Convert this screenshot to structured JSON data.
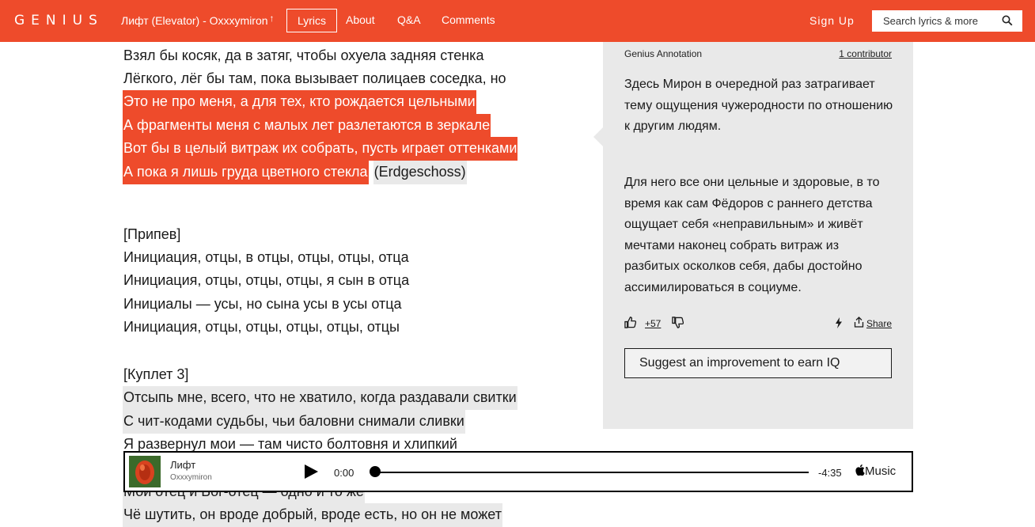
{
  "header": {
    "logo": "GENIUS",
    "song_title": "Лифт (Elevator) - Oxxxymiron",
    "song_title_arrow": "↑",
    "nav": [
      "Lyrics",
      "About",
      "Q&A",
      "Comments"
    ],
    "active_nav": "Lyrics",
    "sign_up": "Sign Up",
    "search_placeholder": "Search lyrics & more",
    "accent_color": "#ee4b2b"
  },
  "lyrics": {
    "lines": [
      {
        "text": "Взял бы косяк, да в затяг, чтобы охуела задняя стенка",
        "highlight": "none"
      },
      {
        "text": "Лёгкого, лёг бы там, пока вызывает полицаев соседка, но",
        "highlight": "none"
      },
      {
        "text": "Это не про меня, а для тех, кто рождается цельными",
        "highlight": "red"
      },
      {
        "text": "А фрагменты меня с малых лет разлетаются в зеркале",
        "highlight": "red"
      },
      {
        "text": "Вот бы в целый витраж их собрать, пусть играет оттенками",
        "highlight": "red"
      },
      {
        "text": "А пока я лишь груда цветного стекла",
        "highlight": "red",
        "suffix": "(Erdgeschoss)"
      },
      {
        "text": "[Припев]",
        "highlight": "none"
      },
      {
        "text": "Инициация, отцы, в отцы, отцы, отцы, отца",
        "highlight": "none"
      },
      {
        "text": "Инициация, отцы, отцы, отцы, я сын в отца",
        "highlight": "none"
      },
      {
        "text": "Инициалы — усы, но сына усы в усы отца",
        "highlight": "none"
      },
      {
        "text": "Инициация, отцы, отцы, отцы, отцы, отцы",
        "highlight": "none"
      },
      {
        "text": "[Куплет 3]",
        "highlight": "none"
      },
      {
        "text": "Отсыпь мне, всего, что не хватило, когда раздавали свитки",
        "highlight": "grey"
      },
      {
        "text": "С чит-кодами судьбы, чьи баловни снимали сливки",
        "highlight": "grey"
      },
      {
        "text": "Я развернул мои — там чисто болтовня и хлипкий",
        "highlight": "none"
      },
      {
        "text": "Мой отец и Бог-отец — одно и то же",
        "highlight": "grey"
      },
      {
        "text": "Чё шутить, он вроде добрый, вроде есть, но он не может",
        "highlight": "grey"
      }
    ]
  },
  "annotation": {
    "label": "Genius Annotation",
    "contributors": "1 contributor",
    "paragraphs": [
      "Здесь Мирон в очередной раз затрагивает тему ощущения чужеродности по отношению к другим людям.",
      "Для него все они цельные и здоровые, в то время как сам Фёдоров с раннего детства ощущает себя «неправильным» и живёт мечтами наконец собрать витраж из разбитых осколков себя, дабы достойно ассимилироваться в социуме."
    ],
    "votes": "+57",
    "share": "Share",
    "suggest": "Suggest an improvement to earn IQ",
    "bg_color": "#e9e9e9"
  },
  "player": {
    "title": "Лифт",
    "artist": "Oxxxymiron",
    "time_start": "0:00",
    "time_end": "-4:35",
    "progress": 0,
    "service": "Music"
  }
}
